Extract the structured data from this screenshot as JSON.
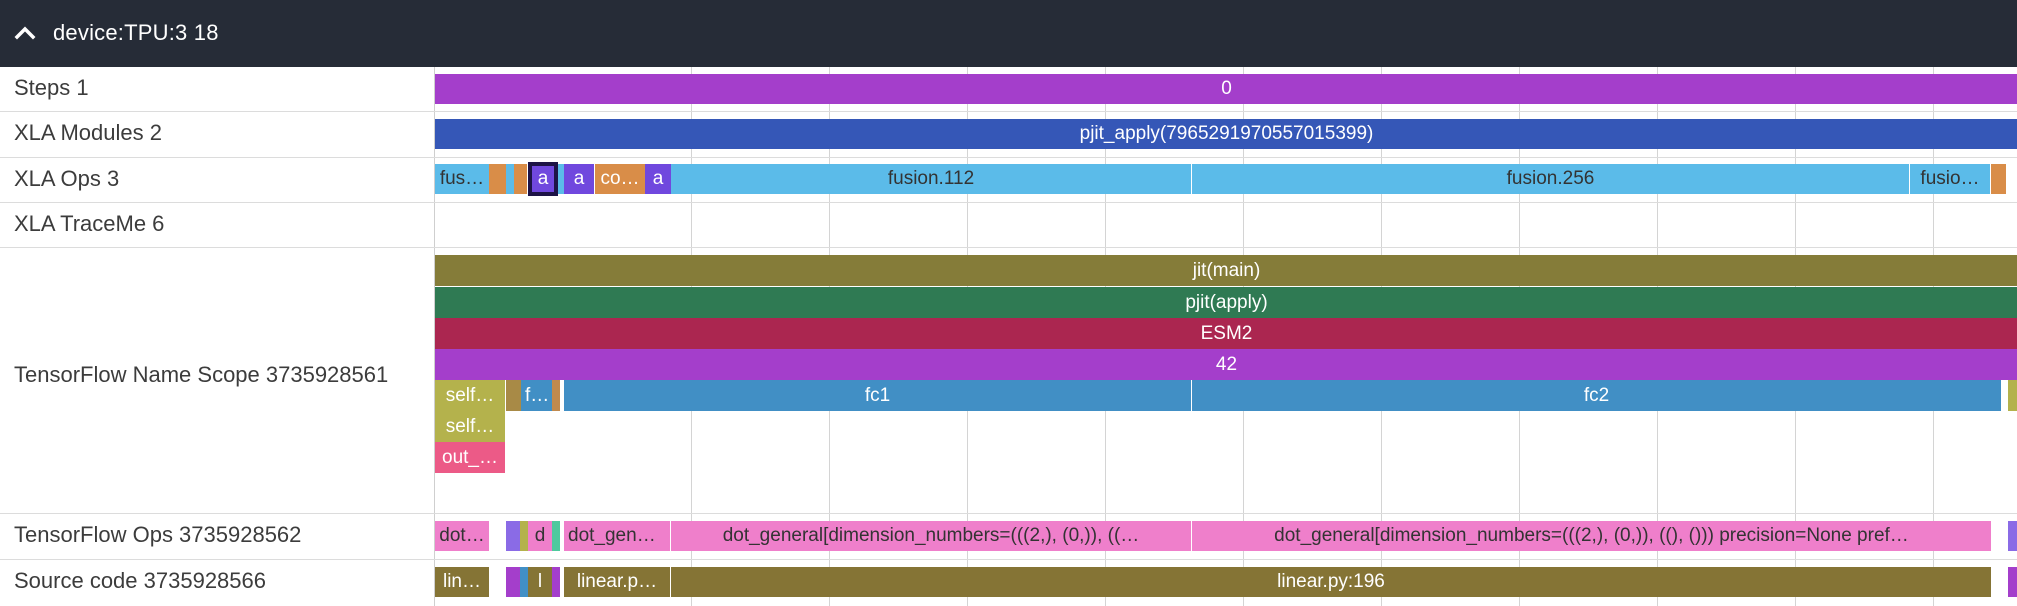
{
  "device": {
    "title": "device:TPU:3 18"
  },
  "rows": {
    "steps": "Steps 1",
    "xla_modules": "XLA Modules 2",
    "xla_ops": "XLA Ops 3",
    "xla_traceme": "XLA TraceMe 6",
    "name_scope": "TensorFlow Name Scope 3735928561",
    "tf_ops": "TensorFlow Ops 3735928562",
    "source": "Source code 3735928566"
  },
  "events": {
    "step_0": "0",
    "module": "pjit_apply(7965291970557015399)",
    "op_fus": "fus…",
    "op_a1": "a",
    "op_a2": "a",
    "op_co": "co…",
    "op_a3": "a",
    "op_fusion112": "fusion.112",
    "op_fusion256": "fusion.256",
    "op_fusio": "fusio…",
    "ns_jit_main": "jit(main)",
    "ns_pjit_apply": "pjit(apply)",
    "ns_esm2": "ESM2",
    "ns_42": "42",
    "ns_self1": "self…",
    "ns_f": "f…",
    "ns_fc1": "fc1",
    "ns_fc2": "fc2",
    "ns_self2": "self…",
    "ns_out": "out_…",
    "tf_dot1": "dot…",
    "tf_d": "d",
    "tf_dot_gene": "dot_gene…",
    "tf_dot_general_a": "dot_general[dimension_numbers=(((2,), (0,)), ((…",
    "tf_dot_general_b": "dot_general[dimension_numbers=(((2,), (0,)), ((), ())) precision=None pref…",
    "src_lin": "lin…",
    "src_l": "l",
    "src_linear_p": "linear.p…",
    "src_linear196": "linear.py:196"
  },
  "colors": {
    "header_bg": "#262c37",
    "steps": "#a43ecb",
    "modules": "#3557b7",
    "xla_ops": "#5bbbe9",
    "jit_main": "#857c39",
    "pjit_apply": "#2f7a53",
    "esm2": "#ab2650",
    "scope_42": "#a43ecb",
    "fc": "#418fc5",
    "tf_ops": "#ef7fcb",
    "source": "#857435"
  },
  "icons": {
    "collapse": "chevron-up-icon"
  }
}
